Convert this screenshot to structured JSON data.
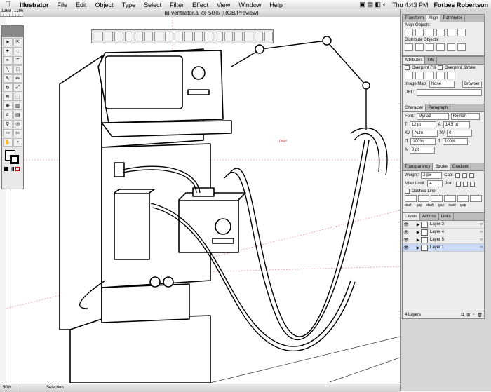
{
  "menubar": {
    "apple": "",
    "items": [
      "Illustrator",
      "File",
      "Edit",
      "Object",
      "Type",
      "Select",
      "Filter",
      "Effect",
      "View",
      "Window",
      "Help"
    ],
    "clock": "Thu 4:43 PM",
    "user": "Forbes Robertson"
  },
  "window": {
    "title": "ventilator.ai @ 50% (RGB/Preview)"
  },
  "ruler": {
    "ticks": [
      "1368",
      "1296",
      "1224",
      "1152",
      "1080",
      "1008",
      "936",
      "864",
      "792",
      "720",
      "648",
      "576",
      "504",
      "432",
      "360",
      "288",
      "216",
      "144",
      "72",
      "0",
      "72",
      "144",
      "216",
      "288",
      "360",
      "432",
      "504",
      "576",
      "648",
      "720",
      "792",
      "864"
    ]
  },
  "canvas": {
    "page_label": "page"
  },
  "panels": {
    "align": {
      "tabs": [
        "Transform",
        "Align",
        "Pathfinder"
      ],
      "active": "Align",
      "align_objects": "Align Objects:",
      "distribute_objects": "Distribute Objects:"
    },
    "attributes": {
      "tabs": [
        "Attributes",
        "Info"
      ],
      "active": "Attributes",
      "overprint_fill": "Overprint Fill",
      "overprint_stroke": "Overprint Stroke",
      "image_map_label": "Image Map:",
      "image_map_value": "None",
      "browser_button": "Browser",
      "url_label": "URL:"
    },
    "character": {
      "tabs": [
        "Character",
        "Paragraph"
      ],
      "active": "Character",
      "font_label": "Font:",
      "font_name": "Myriad",
      "font_style": "Roman",
      "size": "12 pt",
      "leading": "14.5 pt",
      "kerning": "Auto",
      "tracking": "0",
      "vertical_scale": "100%",
      "horizontal_scale": "100%",
      "baseline_shift": "0 pt"
    },
    "stroke": {
      "tabs": [
        "Transparency",
        "Stroke",
        "Gradient"
      ],
      "active": "Stroke",
      "weight_label": "Weight:",
      "weight_value": "2 px",
      "cap_label": "Cap:",
      "miter_label": "Miter Limit:",
      "miter_value": "4",
      "join_label": "Join:",
      "dashed_label": "Dashed Line",
      "dash_labels": [
        "dash",
        "gap",
        "dash",
        "gap",
        "dash",
        "gap"
      ]
    },
    "layers": {
      "tabs": [
        "Layers",
        "Actions",
        "Links"
      ],
      "active": "Layers",
      "items": [
        {
          "name": "Layer 3"
        },
        {
          "name": "Layer 4"
        },
        {
          "name": "Layer 5"
        },
        {
          "name": "Layer 1"
        }
      ],
      "selected_index": 3,
      "count": "4 Layers"
    }
  },
  "status": {
    "zoom": "50%",
    "tool": "Selection"
  },
  "colors": {
    "menubar": "#e8e8e8",
    "panel_bg": "#ececec",
    "selection": "#c9d9f6",
    "guide": "#e07a9a"
  }
}
